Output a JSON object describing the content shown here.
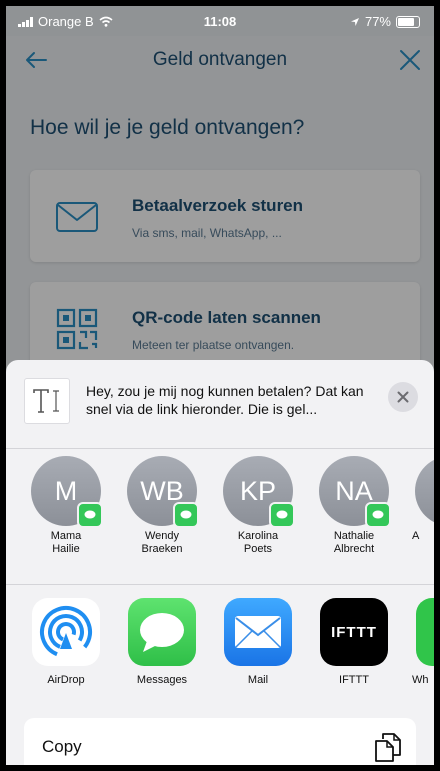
{
  "status_bar": {
    "carrier": "Orange B",
    "time": "11:08",
    "battery": "77%"
  },
  "nav": {
    "title": "Geld ontvangen",
    "back_icon": "arrow-left-icon",
    "close_icon": "close-icon"
  },
  "main": {
    "heading": "Hoe wil je je geld ontvangen?",
    "options": [
      {
        "title": "Betaalverzoek sturen",
        "subtitle": "Via sms, mail, WhatsApp, ...",
        "icon": "envelope-icon"
      },
      {
        "title": "QR-code laten scannen",
        "subtitle": "Meteen ter plaatse ontvangen.",
        "icon": "qr-code-icon"
      }
    ]
  },
  "share_sheet": {
    "preview_text": "Hey, zou je mij nog kunnen betalen? Dat kan snel via de link hieronder. Die is gel...",
    "contacts": [
      {
        "initials": "M",
        "name_line1": "Mama",
        "name_line2": "Hailie"
      },
      {
        "initials": "WB",
        "name_line1": "Wendy",
        "name_line2": "Braeken"
      },
      {
        "initials": "KP",
        "name_line1": "Karolina",
        "name_line2": "Poets"
      },
      {
        "initials": "NA",
        "name_line1": "Nathalie",
        "name_line2": "Albrecht"
      },
      {
        "initials": "",
        "name_line1": "A",
        "name_line2": ""
      }
    ],
    "apps": [
      {
        "label": "AirDrop",
        "icon": "airdrop-icon"
      },
      {
        "label": "Messages",
        "icon": "messages-icon"
      },
      {
        "label": "Mail",
        "icon": "mail-icon"
      },
      {
        "label": "IFTTT",
        "icon": "ifttt-icon",
        "logo_text": "IFTTT"
      },
      {
        "label": "Wh",
        "icon": "whatsapp-icon"
      }
    ],
    "copy_label": "Copy",
    "copy_icon": "copy-icon"
  },
  "colors": {
    "brand_blue": "#1d4f73",
    "icon_blue": "#2a8fc4",
    "messages_green": "#34c759",
    "mail_blue": "#1f8ef1"
  }
}
